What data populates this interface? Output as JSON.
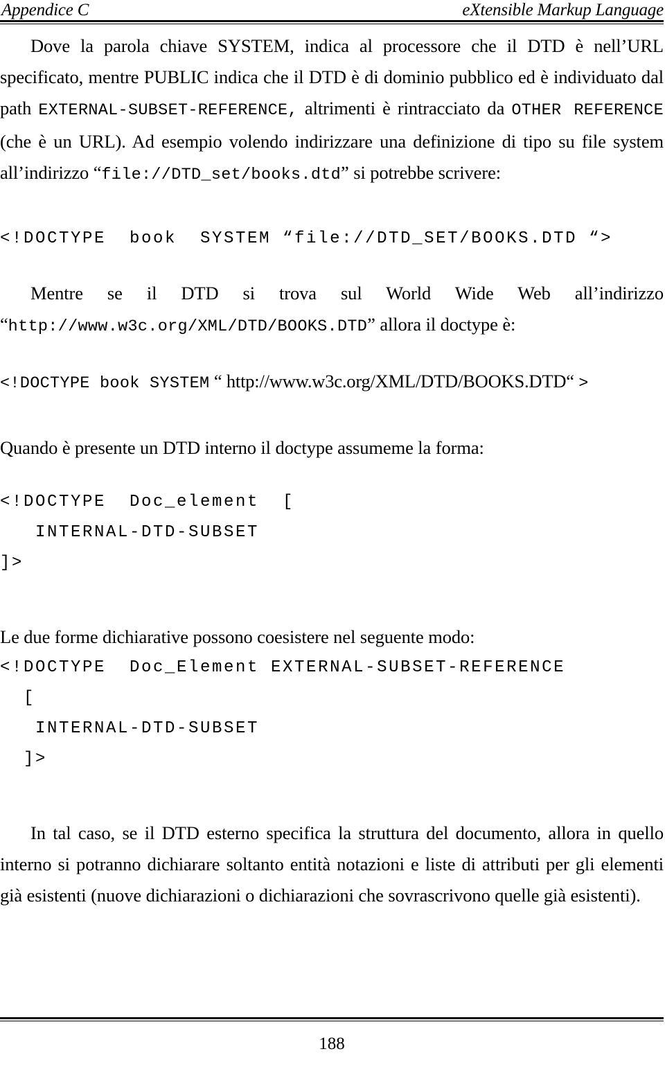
{
  "header": {
    "left": "Appendice C",
    "right": "eXtensible Markup Language"
  },
  "body": {
    "para1": {
      "seg1": "Dove la parola chiave SYSTEM, indica al processore che il DTD è nell’URL specificato, mentre PUBLIC indica che il DTD è di dominio pubblico ed è individuato dal path ",
      "code1": "EXTERNAL-SUBSET-REFERENCE,",
      "seg2": " altrimenti è rintracciato da ",
      "code2": "OTHER REFERENCE",
      "seg3": " (che è un URL). Ad esempio volendo indirizzare una definizione di tipo su file system all’indirizzo “",
      "code3": "file://DTD_set/books.dtd",
      "seg4": "” si potrebbe scrivere:"
    },
    "code_block1": {
      "line1": "<!DOCTYPE  book  SYSTEM “file://DTD_SET/BOOKS.DTD “>"
    },
    "para2": {
      "seg1": "Mentre se il DTD si trova sul World Wide Web all’indirizzo",
      "seg2": "“",
      "code1": "http://www.w3c.org/XML/DTD/BOOKS.DTD",
      "seg3": "” allora il doctype è:"
    },
    "code_block2": {
      "mono_prefix": "<!DOCTYPE book SYSTEM",
      "serif_mid": " “ http://www.w3c.org/XML/DTD/BOOKS.DTD“ ",
      "mono_suffix": ">"
    },
    "para3": "Quando è presente un DTD interno il doctype assumeme la forma:",
    "code_block3": {
      "line1": "<!DOCTYPE  Doc_element  [",
      "line2": "   INTERNAL-DTD-SUBSET",
      "line3": "]>"
    },
    "para4": "Le due forme dichiarative possono coesistere nel seguente modo:",
    "code_block4": {
      "line1": "<!DOCTYPE  Doc_Element EXTERNAL-SUBSET-REFERENCE",
      "line2": "  [",
      "line3": "   INTERNAL-DTD-SUBSET",
      "line4": "  ]>"
    },
    "para5": "In tal caso, se il DTD esterno specifica la struttura del documento, allora in quello interno si potranno dichiarare soltanto entità notazioni e liste di attributi per gli elementi già esistenti (nuove dichiarazioni o dichiarazioni che sovrascrivono quelle già esistenti)."
  },
  "footer": {
    "page_number": "188"
  }
}
